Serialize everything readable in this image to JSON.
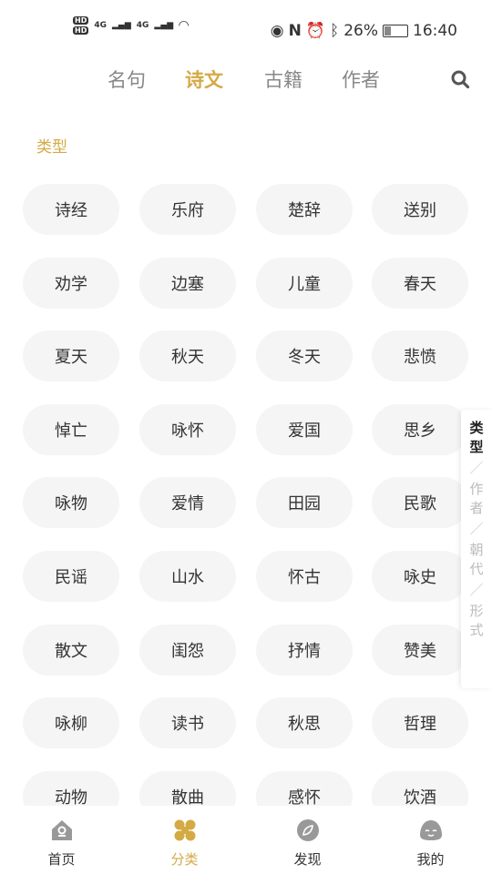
{
  "status_bar": {
    "battery": "26%",
    "time": "16:40",
    "sim1": "HD",
    "sim2": "HD",
    "net1": "4G",
    "net2": "4G"
  },
  "tabs": [
    {
      "label": "名句"
    },
    {
      "label": "诗文",
      "active": true
    },
    {
      "label": "古籍"
    },
    {
      "label": "作者"
    }
  ],
  "section_title": "类型",
  "categories": [
    "诗经",
    "乐府",
    "楚辞",
    "送别",
    "劝学",
    "边塞",
    "儿童",
    "春天",
    "夏天",
    "秋天",
    "冬天",
    "悲愤",
    "悼亡",
    "咏怀",
    "爱国",
    "思乡",
    "咏物",
    "爱情",
    "田园",
    "民歌",
    "民谣",
    "山水",
    "怀古",
    "咏史",
    "散文",
    "闺怨",
    "抒情",
    "赞美",
    "咏柳",
    "读书",
    "秋思",
    "哲理",
    "动物",
    "散曲",
    "感怀",
    "饮酒"
  ],
  "side_index": [
    {
      "label": "类型",
      "active": true
    },
    {
      "label": "作者"
    },
    {
      "label": "朝代"
    },
    {
      "label": "形式"
    }
  ],
  "side_sep": "／",
  "bottom_nav": [
    {
      "label": "首页",
      "icon": "home-icon"
    },
    {
      "label": "分类",
      "icon": "category-icon",
      "active": true
    },
    {
      "label": "发现",
      "icon": "compass-icon"
    },
    {
      "label": "我的",
      "icon": "profile-icon"
    }
  ],
  "colors": {
    "accent": "#d4aa45",
    "icon_gray": "#999999",
    "pill_bg": "#f5f5f5"
  }
}
